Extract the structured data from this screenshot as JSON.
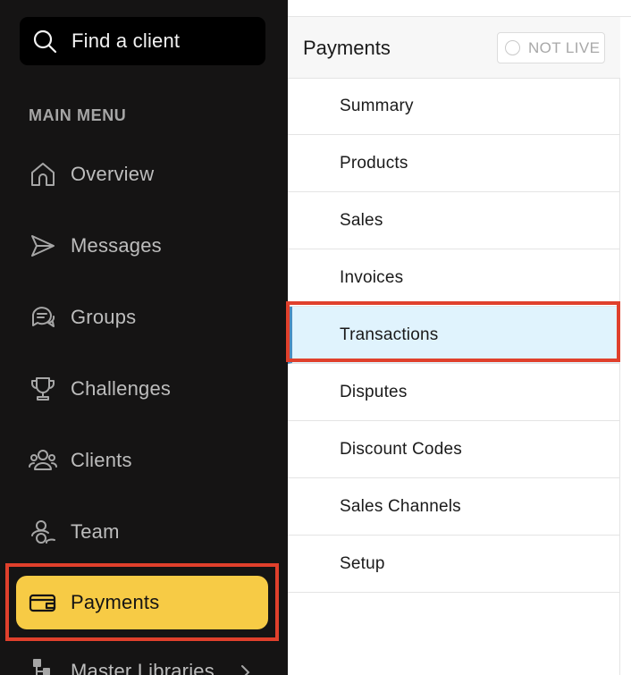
{
  "sidebar": {
    "search": {
      "label": "Find a client",
      "icon": "search-icon"
    },
    "heading": "MAIN MENU",
    "items": [
      {
        "label": "Overview",
        "icon": "home-icon"
      },
      {
        "label": "Messages",
        "icon": "send-icon"
      },
      {
        "label": "Groups",
        "icon": "chat-bubbles-icon"
      },
      {
        "label": "Challenges",
        "icon": "trophy-icon"
      },
      {
        "label": "Clients",
        "icon": "clients-icon"
      },
      {
        "label": "Team",
        "icon": "team-icon"
      },
      {
        "label": "Payments",
        "icon": "wallet-icon",
        "active": true
      },
      {
        "label": "Master Libraries",
        "icon": "hierarchy-icon",
        "has_submenu": true
      }
    ]
  },
  "panel": {
    "title": "Payments",
    "live_badge": "NOT LIVE",
    "items": [
      {
        "label": "Summary"
      },
      {
        "label": "Products"
      },
      {
        "label": "Sales"
      },
      {
        "label": "Invoices"
      },
      {
        "label": "Transactions",
        "active": true
      },
      {
        "label": "Disputes"
      },
      {
        "label": "Discount Codes"
      },
      {
        "label": "Sales Channels"
      },
      {
        "label": "Setup"
      }
    ]
  },
  "colors": {
    "sidebar_bg": "#151414",
    "active_nav": "#f7cb45",
    "active_sub_bg": "#e0f3fd",
    "active_sub_bar": "#4a8fc2",
    "highlight": "#e0402c"
  }
}
